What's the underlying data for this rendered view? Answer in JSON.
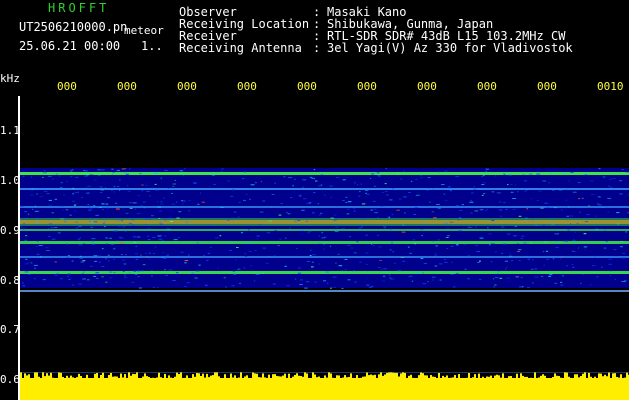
{
  "header": {
    "app_title": "HROFFT",
    "file_name": "UT2506210000.pn",
    "meteor_label": "meteor",
    "datetime": "25.06.21 00:00",
    "count": "1..",
    "info": [
      {
        "label": "Observer",
        "value": "Masaki Kano"
      },
      {
        "label": "Receiving Location",
        "value": "Shibukawa, Gunma, Japan"
      },
      {
        "label": "Receiver",
        "value": "RTL-SDR SDR# 43dB L15 103.2MHz CW"
      },
      {
        "label": "Receiving Antenna",
        "value": "3el Yagi(V) Az 330 for Vladivostok"
      }
    ],
    "colon": ":"
  },
  "axes": {
    "y_unit": "kHz",
    "y_ticks": [
      "1.1",
      "1.0",
      "0.9",
      "0.8",
      "0.7",
      "0.6"
    ],
    "x_ticks": [
      "000",
      "000",
      "000",
      "000",
      "000",
      "000",
      "000",
      "000",
      "000",
      "0010"
    ]
  },
  "colors": {
    "background": "#000000",
    "spectrogram_base": "#00008c",
    "band_hot": "#ff4020",
    "band_warm": "#40ff40",
    "strip": "#ffee00",
    "title_green": "#2fd02f",
    "tick_yellow": "#ffff40"
  }
}
